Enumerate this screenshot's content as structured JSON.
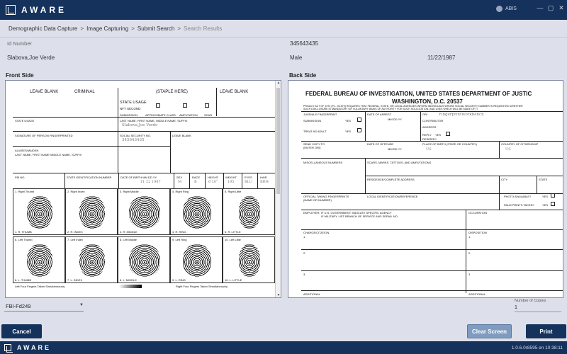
{
  "app": {
    "brand": "AWARE",
    "user": "ABIS",
    "win_buttons": [
      "—",
      "▢",
      "✕"
    ]
  },
  "breadcrumb": {
    "items": [
      "Demographic Data Capture",
      "Image Capturing",
      "Submit Search",
      "Search Results"
    ],
    "separator": ">"
  },
  "subject": {
    "id_label": "Id Number",
    "id_value": "345643435",
    "name": "Slabova,Joe Verde",
    "sex": "Male",
    "dob": "11/22/1987"
  },
  "sections": {
    "front": "Front Side",
    "back": "Back Side"
  },
  "front_card": {
    "leave_blank_left": "LEAVE BLANK",
    "criminal": "CRIMINAL",
    "staple": "(STAPLE HERE)",
    "leave_blank_right": "LEAVE BLANK",
    "state_usage": "STATE USAGE",
    "nfy_second": "NFY SECOND",
    "submission": "SUBMISSION",
    "approx_class": "APPROXIMATE CLASS",
    "amputation": "AMPUTATION",
    "scar": "SCAR",
    "state_usage_small": "STATE USAGE",
    "name_label": "LAST NAME, FIRST NAME, MIDDLE NAME, SUFFIX",
    "name_value": "Slabova,Joe Verde",
    "signature": "SIGNATURE OF PERSON FINGERPRINTED",
    "ssn_label": "SOCIAL SECURITY NO.",
    "ssn_value": "345643435",
    "leave_blank_small": "LEAVE BLANK",
    "aliases": "ALIASES/MAIDEN",
    "aliases_sub": "LAST NAME, FIRST NAME MIDDLE NAME, SUFFIX",
    "fbi_no": "FBI NO.",
    "state_id": "STATE IDENTIFICATION NUMBER",
    "dob_label": "DATE OF BIRTH  MM  DD  YY",
    "dob_value": "11  22  1987",
    "sex": "SEX",
    "race": "RACE",
    "height": "HEIGHT",
    "weight": "WEIGHT",
    "eyes": "EYES",
    "hair": "HAIR",
    "sex_v": "M",
    "race_v": "B",
    "height_v": "6'10\"",
    "weight_v": "195",
    "eyes_v": "BLU",
    "hair_v": "BRW",
    "row1": [
      "1. Right Thumb",
      "2. Right Index",
      "3. Right Middle",
      "4. Right Ring",
      "5. Right Little"
    ],
    "row1_bottom": [
      "1. R. THUMB",
      "2. R. INDEX",
      "3. R. MIDDLE",
      "4. R. RING",
      "5. R. LITTLE"
    ],
    "row2": [
      "6. Left Thumb",
      "7. Left Index",
      "8. Left Middle",
      "9. Left Ring",
      "10. Left Little"
    ],
    "row2_bottom": [
      "6. L. THUMB",
      "7. L. INDEX",
      "8. L. MIDDLE",
      "9. L. RING",
      "10. L. LITTLE"
    ],
    "footer_left": "Left Four Fingers Taken Simultaneously",
    "footer_right": "Right Four Fingers Taken Simultaneously"
  },
  "back_card": {
    "title1": "FEDERAL BUREAU OF INVESTIGATION, UNITED STATES DEPARTMENT OF JUSTIC",
    "title2": "WASHINGTON, D.C. 20537",
    "privacy": "PRIVACY ACT OF 1974 (P.L. 93-579) REQUIRES THAT FEDERAL, STATE, OR LOCAL AGENCIES INFORM INDIVIDUALS WHOSE SOCIAL SECURITY NUMBER IS REQUESTED WHETHER",
    "privacy2": "SUCH DISCLOSURE IS MANDATORY OR VOLUNTARY, BASIS OF AUTHORITY FOR SUCH SOLICITATION, AND USES WHICH WILL BE MADE OF IT",
    "juvenile": "JUVENILE FINGERPRINT",
    "date_arrest": "DATE OF ARREST",
    "ori": "ORI",
    "ori_value": "FingerprintWorkbench",
    "submission": "SUBMISSION",
    "yes": "YES",
    "mmddyy": "MM   DD   YY",
    "contributor": "CONTRIBUTOR",
    "treat_adult": "TREAT AS ADULT",
    "address": "ADDRESS",
    "reply": "REPLY",
    "desired": "DESIRED?",
    "send_copy": "SEND COPY TO",
    "enter_ori": "(ENTER ORI)",
    "date_offense": "DATE OF OFFENSE",
    "place_birth": "PLACE OF BIRTH (STATE OR COUNTRY)",
    "place_birth_v": "US",
    "citizenship": "COUNTRY OF CITIZENSHIP",
    "citizenship_v": "US",
    "misc": "MISCELLANEOUS NUMBERS",
    "scars": "SCARS, MARKS, TATTOOS, AND AMPUTATIONS",
    "residence": "RESIDENCE/COMPLETE ADDRESS",
    "city": "CITY",
    "state": "STATE",
    "official": "OFFICIAL TAKING FINGERPRINTS",
    "name_number": "(NAME OR NUMBER)",
    "local_id": "LOCAL IDENTIFICATION/REFERENCE",
    "photo": "PHOTO AVAILABLE?",
    "palm": "PALM PRINTS TAKEN?",
    "employer": "EMPLOYER:",
    "emp_usgov": "IF U.S. GOVERNMENT, INDICATE SPECIFIC AGENCY",
    "emp_military": "IF MILITARY, LIST BRANCH OF SERVICE AND SERIAL NO.",
    "occupation": "OCCUPATION",
    "charge": "CHARGE/CITATION",
    "disposition": "DISPOSITION",
    "additional": "ADDITIONAL",
    "n1": "1.",
    "n2": "2.",
    "n3": "3."
  },
  "controls": {
    "card_type": "FBI-Fd249",
    "copies_label": "Number of Copies",
    "copies_value": "1",
    "cancel": "Cancel",
    "clear": "Clear Screen",
    "print": "Print"
  },
  "footer": {
    "brand": "AWARE",
    "version": "1.0.6.0r8595  en  10:38:11"
  },
  "colors": {
    "navy": "#14325c",
    "clear_btn": "#7f9bbf",
    "bg": "#dde0ea"
  }
}
